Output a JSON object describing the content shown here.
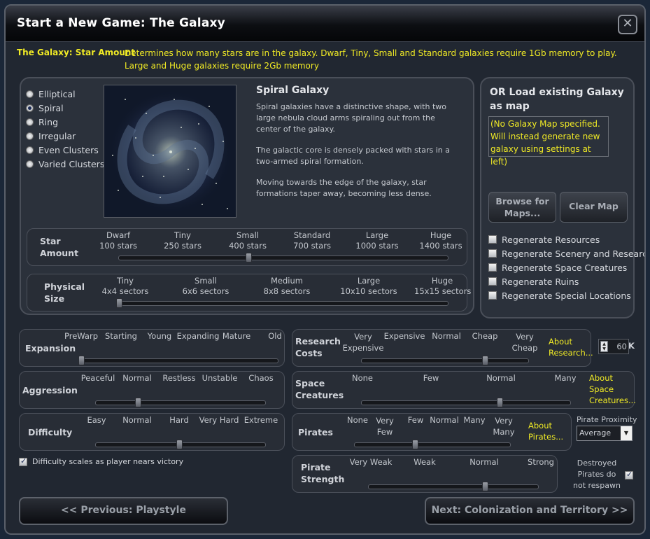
{
  "window": {
    "title": "Start a New Game: The Galaxy",
    "close_icon": "close-icon"
  },
  "hint": {
    "label": "The Galaxy: Star Amount",
    "text": "Determines how many stars are in the galaxy. Dwarf, Tiny, Small and Standard galaxies require 1Gb memory to play. Large and Huge galaxies require 2Gb memory"
  },
  "shape": {
    "options": [
      "Elliptical",
      "Spiral",
      "Ring",
      "Irregular",
      "Even Clusters",
      "Varied Clusters"
    ],
    "selected": "Spiral",
    "title": "Spiral Galaxy",
    "desc1": "Spiral galaxies have a distinctive shape, with two large nebula cloud arms spiraling out from the center of the galaxy.",
    "desc2": "The galactic core is densely packed with stars in a two-armed spiral formation.",
    "desc3": "Moving towards the edge of the galaxy, star formations taper away, becoming less dense."
  },
  "star_amount": {
    "label": "Star Amount",
    "ticks": [
      [
        "Dwarf",
        "100 stars"
      ],
      [
        "Tiny",
        "250 stars"
      ],
      [
        "Small",
        "400 stars"
      ],
      [
        "Standard",
        "700 stars"
      ],
      [
        "Large",
        "1000 stars"
      ],
      [
        "Huge",
        "1400 stars"
      ]
    ],
    "value_index": 2
  },
  "physical_size": {
    "label": "Physical Size",
    "ticks": [
      [
        "Tiny",
        "4x4 sectors"
      ],
      [
        "Small",
        "6x6 sectors"
      ],
      [
        "Medium",
        "8x8 sectors"
      ],
      [
        "Large",
        "10x10 sectors"
      ],
      [
        "Huge",
        "15x15 sectors"
      ]
    ],
    "value_index": 0
  },
  "load_map": {
    "title": "OR Load existing Galaxy as map",
    "message": "(No Galaxy Map specified. Will instead generate new galaxy using settings at left)",
    "browse": "Browse for Maps...",
    "clear": "Clear Map"
  },
  "regenerate": [
    {
      "label": "Regenerate Resources",
      "checked": false
    },
    {
      "label": "Regenerate Scenery and Research",
      "checked": false
    },
    {
      "label": "Regenerate Space Creatures",
      "checked": false
    },
    {
      "label": "Regenerate Ruins",
      "checked": false
    },
    {
      "label": "Regenerate Special Locations",
      "checked": false
    }
  ],
  "expansion": {
    "label": "Expansion",
    "ticks": [
      "PreWarp",
      "Starting",
      "Young",
      "Expanding",
      "Mature",
      "Old"
    ],
    "value_index": 0
  },
  "aggression": {
    "label": "Aggression",
    "ticks": [
      "Peaceful",
      "Normal",
      "Restless",
      "Unstable",
      "Chaos"
    ],
    "value_index": 1
  },
  "difficulty": {
    "label": "Difficulty",
    "ticks": [
      "Easy",
      "Normal",
      "Hard",
      "Very Hard",
      "Extreme"
    ],
    "value_index": 2,
    "scales_label": "Difficulty scales as player nears victory",
    "scales_checked": true
  },
  "research": {
    "label": "Research Costs",
    "ticks": [
      "Very Expensive",
      "Expensive",
      "Normal",
      "Cheap",
      "Very Cheap"
    ],
    "value_index": 3,
    "about": "About Research...",
    "spinner_value": "60",
    "spinner_unit": "K"
  },
  "creatures": {
    "label": "Space Creatures",
    "ticks": [
      "None",
      "Few",
      "Normal",
      "Many"
    ],
    "value_index": 2,
    "about": "About Space Creatures..."
  },
  "pirates": {
    "label": "Pirates",
    "ticks": [
      "None",
      "Very Few",
      "Few",
      "Normal",
      "Many",
      "Very Many"
    ],
    "value_index": 2,
    "about": "About Pirates...",
    "proximity_label": "Pirate Proximity",
    "proximity_value": "Average"
  },
  "pirate_strength": {
    "label": "Pirate Strength",
    "ticks": [
      "Very Weak",
      "Weak",
      "Normal",
      "Strong"
    ],
    "value_index": 2,
    "destroyed_label": "Destroyed Pirates do not respawn",
    "destroyed_checked": true
  },
  "nav": {
    "prev": "<< Previous: Playstyle",
    "next": "Next: Colonization and Territory >>"
  }
}
